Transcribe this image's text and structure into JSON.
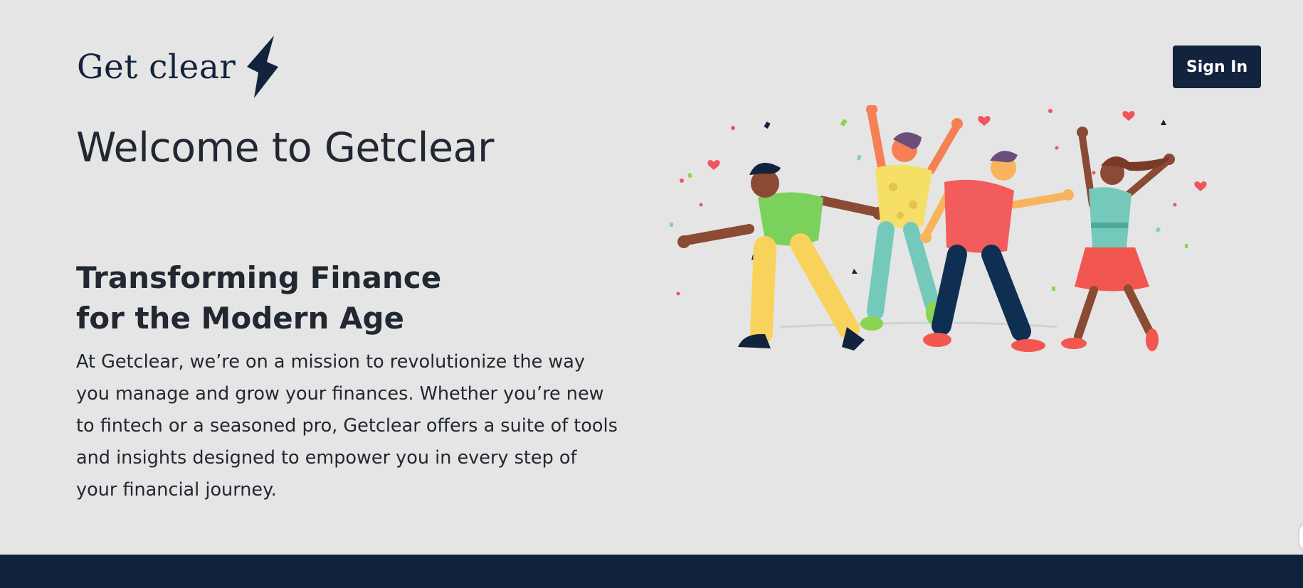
{
  "brand": {
    "name": "Get clear",
    "logo_icon": "lightning-bolt-icon",
    "color": "#13233d"
  },
  "header": {
    "signin_label": "Sign In"
  },
  "hero": {
    "welcome": "Welcome to Getclear",
    "tagline_line1": "Transforming Finance",
    "tagline_line2": "for the Modern Age",
    "description_lines": [
      "At Getclear, we’re on a mission to revolutionize the way",
      "you manage and grow your finances. Whether you’re new",
      "to fintech or a seasoned pro, Getclear offers a suite of tools",
      "and insights designed to empower you in every step of",
      "your financial journey."
    ]
  },
  "illustration": {
    "subject": "four-people-dancing-with-confetti"
  },
  "colors": {
    "background": "#e5e5e5",
    "navy": "#0f233d",
    "text": "#222831"
  }
}
